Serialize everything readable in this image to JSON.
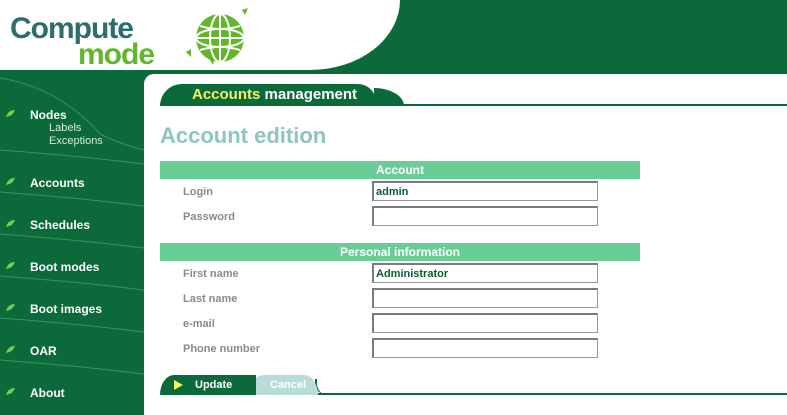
{
  "app": {
    "logo_word1": "Compute",
    "logo_word2": "mode"
  },
  "sidebar": {
    "items": [
      {
        "label": "Nodes",
        "icon": "leaf-icon"
      },
      {
        "label": "Accounts",
        "icon": "leaf-icon"
      },
      {
        "label": "Schedules",
        "icon": "leaf-icon"
      },
      {
        "label": "Boot modes",
        "icon": "leaf-icon"
      },
      {
        "label": "Boot images",
        "icon": "leaf-icon"
      },
      {
        "label": "OAR",
        "icon": "leaf-icon"
      },
      {
        "label": "About",
        "icon": "leaf-icon"
      }
    ],
    "subitems": [
      {
        "label": "Labels"
      },
      {
        "label": "Exceptions"
      }
    ]
  },
  "header": {
    "title_accent": "Accounts",
    "title_rest": "management"
  },
  "main": {
    "page_title": "Account edition",
    "sections": {
      "account": {
        "title": "Account",
        "fields": [
          {
            "label": "Login",
            "value": "admin"
          },
          {
            "label": "Password",
            "value": ""
          }
        ]
      },
      "personal": {
        "title": "Personal information",
        "fields": [
          {
            "label": "First name",
            "value": "Administrator"
          },
          {
            "label": "Last name",
            "value": ""
          },
          {
            "label": "e-mail",
            "value": ""
          },
          {
            "label": "Phone number",
            "value": ""
          }
        ]
      }
    }
  },
  "buttons": {
    "update": "Update",
    "cancel": "Cancel"
  },
  "colors": {
    "brand_green": "#0c6a3a",
    "section_green": "#69cd96",
    "accent_yellow": "#f2f06a",
    "title_teal": "#8dc5bf",
    "logo_lime": "#61b62c"
  }
}
